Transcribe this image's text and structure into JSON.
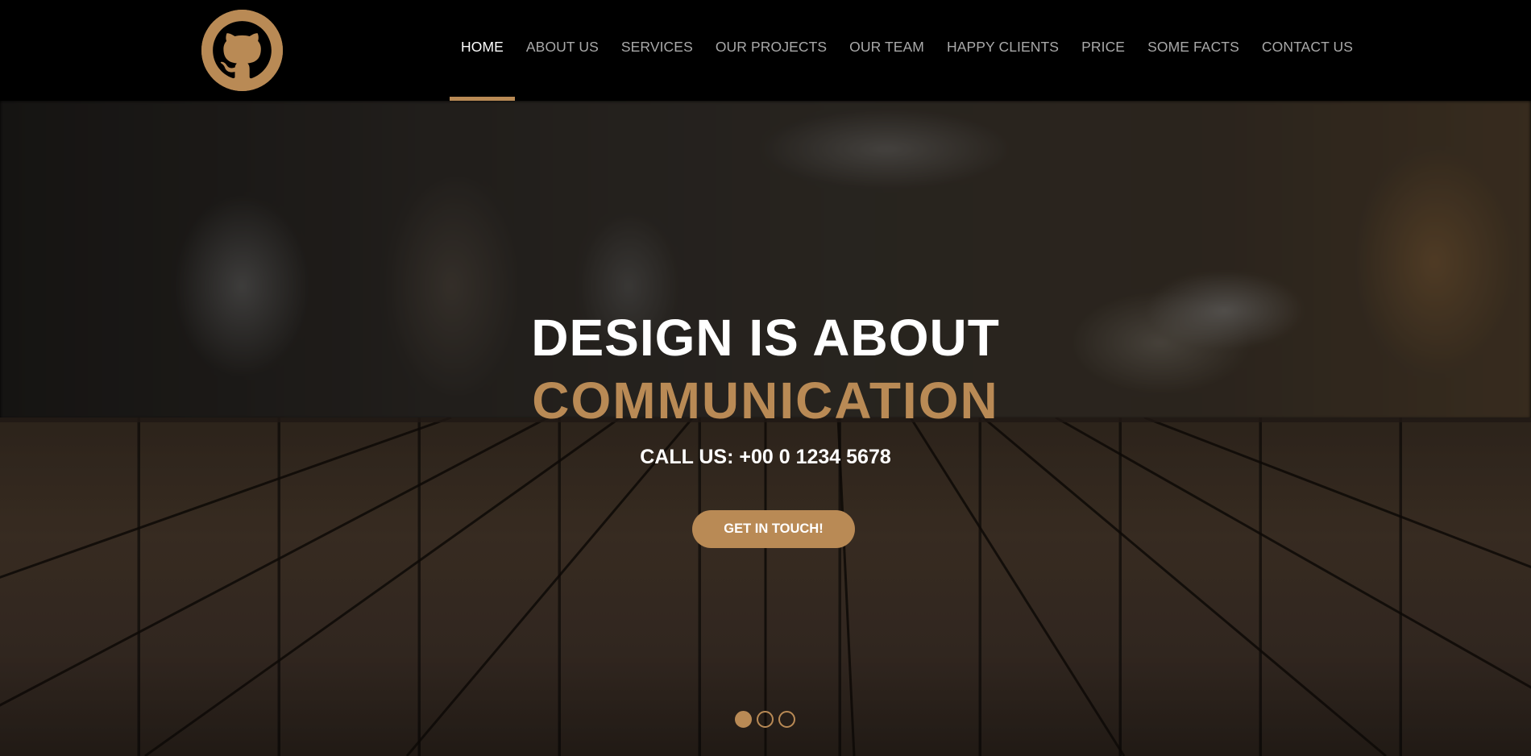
{
  "brand": {
    "logo_icon": "github-octocat-icon",
    "accent_color": "#b98a55"
  },
  "nav": {
    "items": [
      {
        "label": "HOME",
        "active": true
      },
      {
        "label": "ABOUT US",
        "active": false
      },
      {
        "label": "SERVICES",
        "active": false
      },
      {
        "label": "OUR PROJECTS",
        "active": false
      },
      {
        "label": "OUR TEAM",
        "active": false
      },
      {
        "label": "HAPPY CLIENTS",
        "active": false
      },
      {
        "label": "PRICE",
        "active": false
      },
      {
        "label": "SOME FACTS",
        "active": false
      },
      {
        "label": "CONTACT US",
        "active": false
      }
    ]
  },
  "hero": {
    "headline_line1": "DESIGN IS ABOUT",
    "headline_line2": "COMMUNICATION",
    "phone_text": "CALL US: +00 0 1234 5678",
    "cta_label": "GET IN TOUCH!",
    "slider": {
      "count": 3,
      "active_index": 0
    }
  }
}
